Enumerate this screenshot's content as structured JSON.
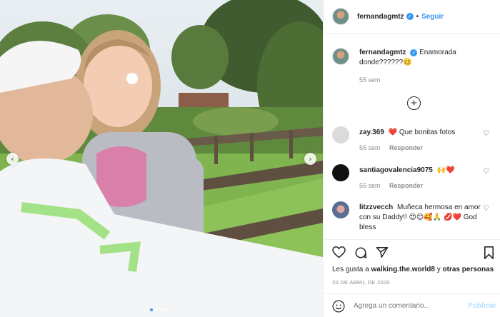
{
  "post": {
    "username": "fernandagmtz",
    "follow_label": "Seguir",
    "separator": "•",
    "verified_icon": "verified-badge-icon",
    "accent": "#3897f0"
  },
  "caption": {
    "username": "fernandagmtz",
    "text": "Enamorada donde??????🥴",
    "time": "55 sem"
  },
  "comments": [
    {
      "username": "zay.369",
      "text": "❤️ Que bonitas fotos",
      "time": "55 sem",
      "reply_label": "Responder"
    },
    {
      "username": "santiagovalencia9075",
      "text": "🙌❤️",
      "time": "55 sem",
      "reply_label": "Responder"
    },
    {
      "username": "litzzvecch",
      "text": "Muñeca hermosa en amor con su Daddy!! 😍😊🥰🙏 💋❤️ God bless"
    }
  ],
  "likes": {
    "prefix": "Les gusta a",
    "user": "walking.the.world8",
    "connector": "y",
    "others": "otras personas"
  },
  "date": "20 DE ABRIL DE 2020",
  "add_comment": {
    "placeholder": "Agrega un comentario...",
    "publish_label": "Publicar"
  },
  "carousel": {
    "slide_count": 4,
    "active_index": 0
  }
}
